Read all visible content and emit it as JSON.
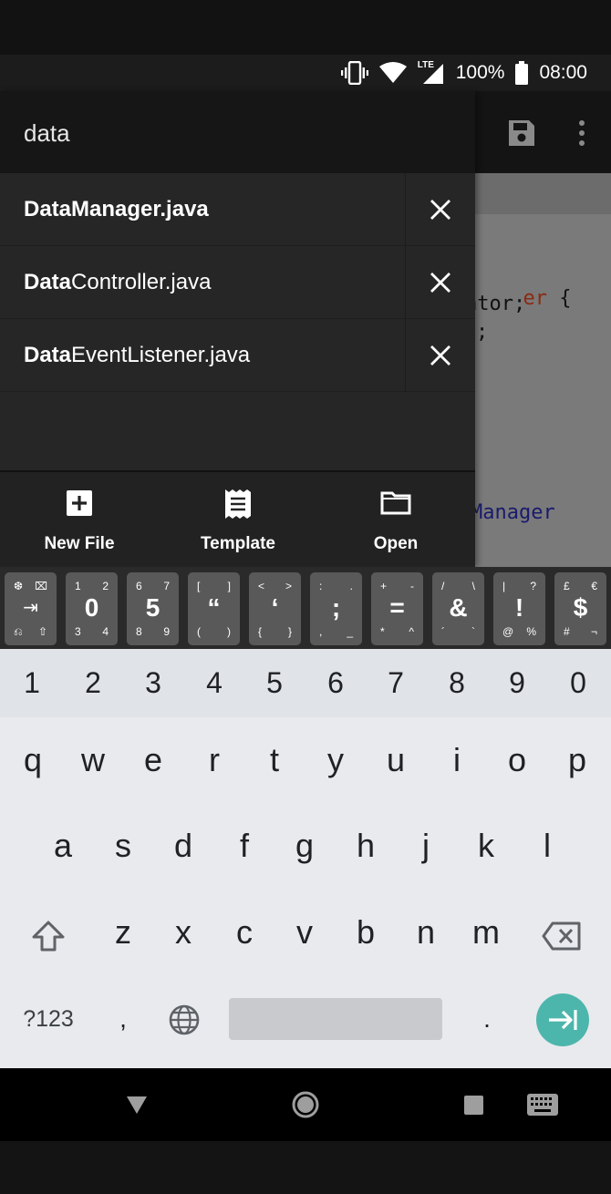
{
  "status_bar": {
    "network": "LTE",
    "battery": "100%",
    "time": "08:00"
  },
  "editor": {
    "code_fragments": [
      {
        "text": "er",
        "suffix": " {",
        "color": "#8b2a12"
      },
      {
        "text": "ator;",
        "suffix": "",
        "color": "#111111"
      },
      {
        "text": ";",
        "suffix": "",
        "color": "#111111"
      },
      {
        "text": "er",
        "suffix": "",
        "color": "#8b2a12"
      },
      {
        "text": "Manager",
        "suffix": "",
        "color": "#1a1a6e"
      }
    ]
  },
  "search": {
    "value": "data"
  },
  "results": [
    {
      "match": "DataManager.java",
      "rest": ""
    },
    {
      "match": "Data",
      "rest": "Controller.java"
    },
    {
      "match": "Data",
      "rest": "EventListener.java"
    }
  ],
  "actions": {
    "new_file": "New File",
    "template": "Template",
    "open": "Open"
  },
  "symbol_keys": [
    {
      "main": "",
      "tl": "❆",
      "tr": "⌧",
      "bl": "⎌",
      "br": "⇧",
      "mid": "⇥"
    },
    {
      "main": "0",
      "tl": "1",
      "tr": "2",
      "bl": "3",
      "br": "4"
    },
    {
      "main": "5",
      "tl": "6",
      "tr": "7",
      "bl": "8",
      "br": "9"
    },
    {
      "main": "“",
      "tl": "[",
      "tr": "]",
      "bl": "(",
      "br": ")"
    },
    {
      "main": "‘",
      "tl": "<",
      "tr": ">",
      "bl": "{",
      "br": "}"
    },
    {
      "main": ";",
      "tl": ":",
      "tr": ".",
      "bl": ",",
      "br": "_"
    },
    {
      "main": "=",
      "tl": "+",
      "tr": "-",
      "bl": "*",
      "br": "^"
    },
    {
      "main": "&",
      "tl": "/",
      "tr": "\\",
      "bl": "´",
      "br": "`"
    },
    {
      "main": "!",
      "tl": "|",
      "tr": "?",
      "bl": "@",
      "br": "%"
    },
    {
      "main": "$",
      "tl": "£",
      "tr": "€",
      "bl": "#",
      "br": "¬"
    }
  ],
  "keyboard": {
    "numbers": [
      "1",
      "2",
      "3",
      "4",
      "5",
      "6",
      "7",
      "8",
      "9",
      "0"
    ],
    "row1": [
      "q",
      "w",
      "e",
      "r",
      "t",
      "y",
      "u",
      "i",
      "o",
      "p"
    ],
    "row2": [
      "a",
      "s",
      "d",
      "f",
      "g",
      "h",
      "j",
      "k",
      "l"
    ],
    "row3": [
      "z",
      "x",
      "c",
      "v",
      "b",
      "n",
      "m"
    ],
    "symbols_label": "?123",
    "comma": ",",
    "period": ".",
    "accent_color": "#4db6ac"
  }
}
